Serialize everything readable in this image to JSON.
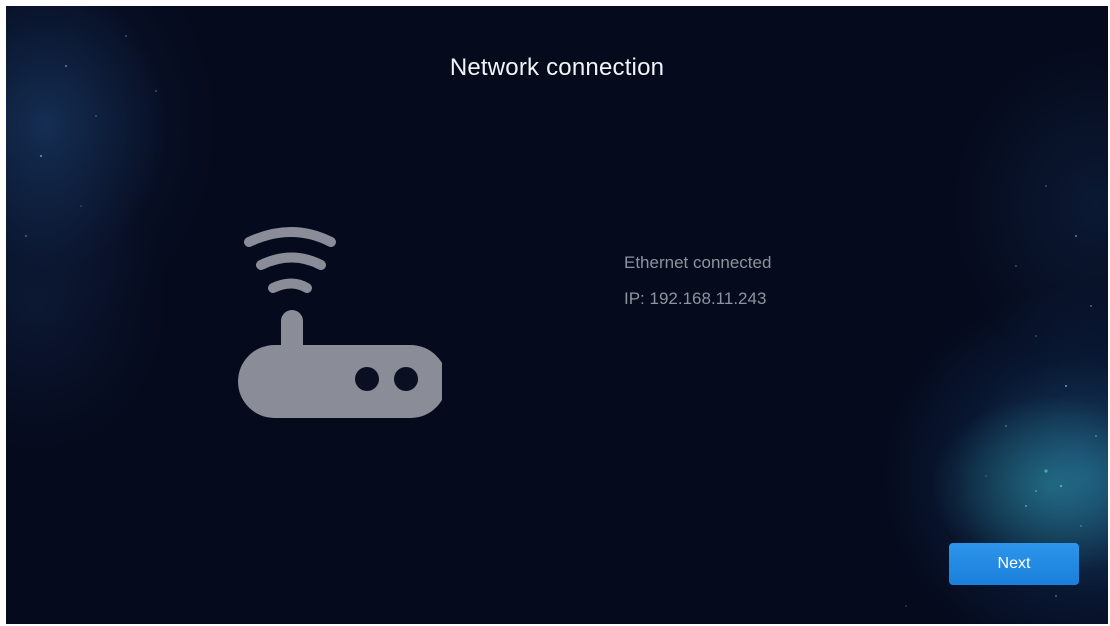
{
  "page": {
    "title": "Network connection"
  },
  "status": {
    "connection": "Ethernet connected",
    "ip": "IP: 192.168.11.243"
  },
  "actions": {
    "next_label": "Next"
  },
  "icons": {
    "router": "router-wifi-icon"
  },
  "colors": {
    "background": "#050a1c",
    "title": "#f2f4f8",
    "status_text": "#8e939f",
    "icon": "#8a8d97",
    "button": "#2290e6",
    "button_text": "#ffffff"
  }
}
